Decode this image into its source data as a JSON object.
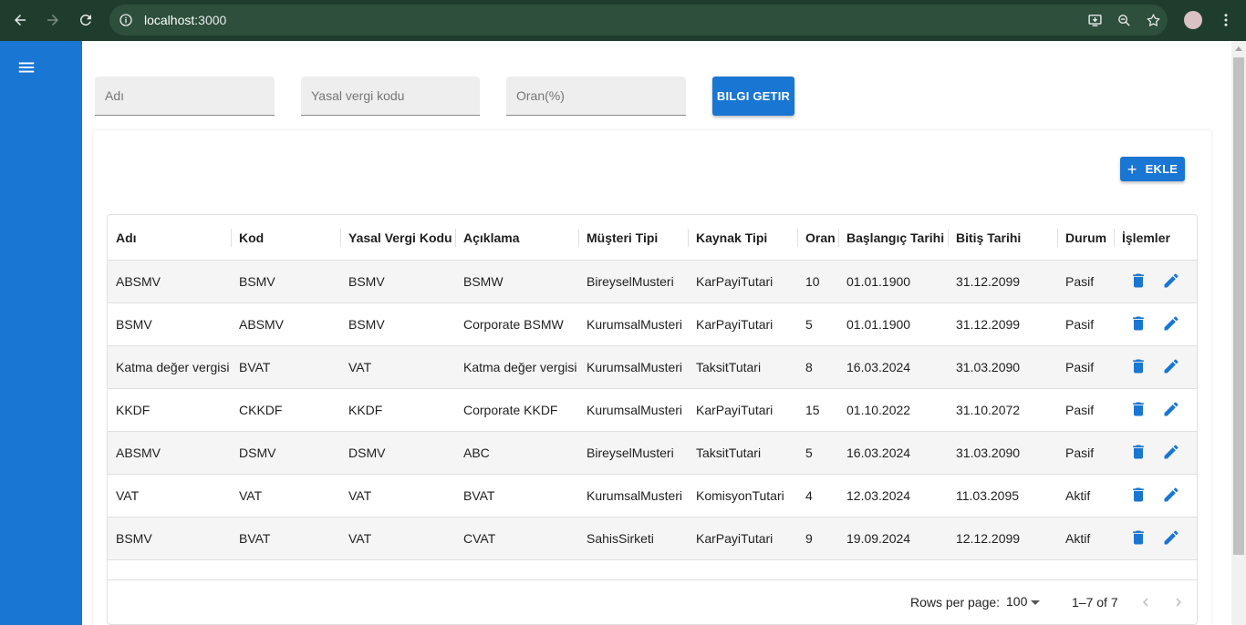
{
  "browser": {
    "url_host": "localhost",
    "url_port": ":3000"
  },
  "filters": {
    "name_placeholder": "Adı",
    "tax_code_placeholder": "Yasal vergi kodu",
    "rate_placeholder": "Oran(%)",
    "fetch_button": "BILGI GETIR"
  },
  "toolbar": {
    "add_button": "EKLE"
  },
  "table": {
    "columns": [
      "Adı",
      "Kod",
      "Yasal Vergi Kodu",
      "Açıklama",
      "Müşteri Tipi",
      "Kaynak Tipi",
      "Oran",
      "Başlangıç Tarihi",
      "Bitiş Tarihi",
      "Durum",
      "İşlemler"
    ],
    "rows": [
      [
        "ABSMV",
        "BSMV",
        "BSMV",
        "BSMW",
        "BireyselMusteri",
        "KarPayiTutari",
        "10",
        "01.01.1900",
        "31.12.2099",
        "Pasif"
      ],
      [
        "BSMV",
        "ABSMV",
        "BSMV",
        "Corporate BSMW",
        "KurumsalMusteri",
        "KarPayiTutari",
        "5",
        "01.01.1900",
        "31.12.2099",
        "Pasif"
      ],
      [
        "Katma değer vergisi",
        "BVAT",
        "VAT",
        "Katma değer vergisi",
        "KurumsalMusteri",
        "TaksitTutari",
        "8",
        "16.03.2024",
        "31.03.2090",
        "Pasif"
      ],
      [
        "KKDF",
        "CKKDF",
        "KKDF",
        "Corporate KKDF",
        "KurumsalMusteri",
        "KarPayiTutari",
        "15",
        "01.10.2022",
        "31.10.2072",
        "Pasif"
      ],
      [
        "ABSMV",
        "DSMV",
        "DSMV",
        "ABC",
        "BireyselMusteri",
        "TaksitTutari",
        "5",
        "16.03.2024",
        "31.03.2090",
        "Pasif"
      ],
      [
        "VAT",
        "VAT",
        "VAT",
        "BVAT",
        "KurumsalMusteri",
        "KomisyonTutari",
        "4",
        "12.03.2024",
        "11.03.2095",
        "Aktif"
      ],
      [
        "BSMV",
        "BVAT",
        "VAT",
        "CVAT",
        "SahisSirketi",
        "KarPayiTutari",
        "9",
        "19.09.2024",
        "12.12.2099",
        "Aktif"
      ]
    ]
  },
  "pagination": {
    "rows_per_page_label": "Rows per page:",
    "rows_per_page_value": "100",
    "range_text": "1–7 of 7"
  },
  "colors": {
    "primary": "#1976d2",
    "browser_frame": "#1f3d2d",
    "row_shade": "#f5f5f5"
  }
}
